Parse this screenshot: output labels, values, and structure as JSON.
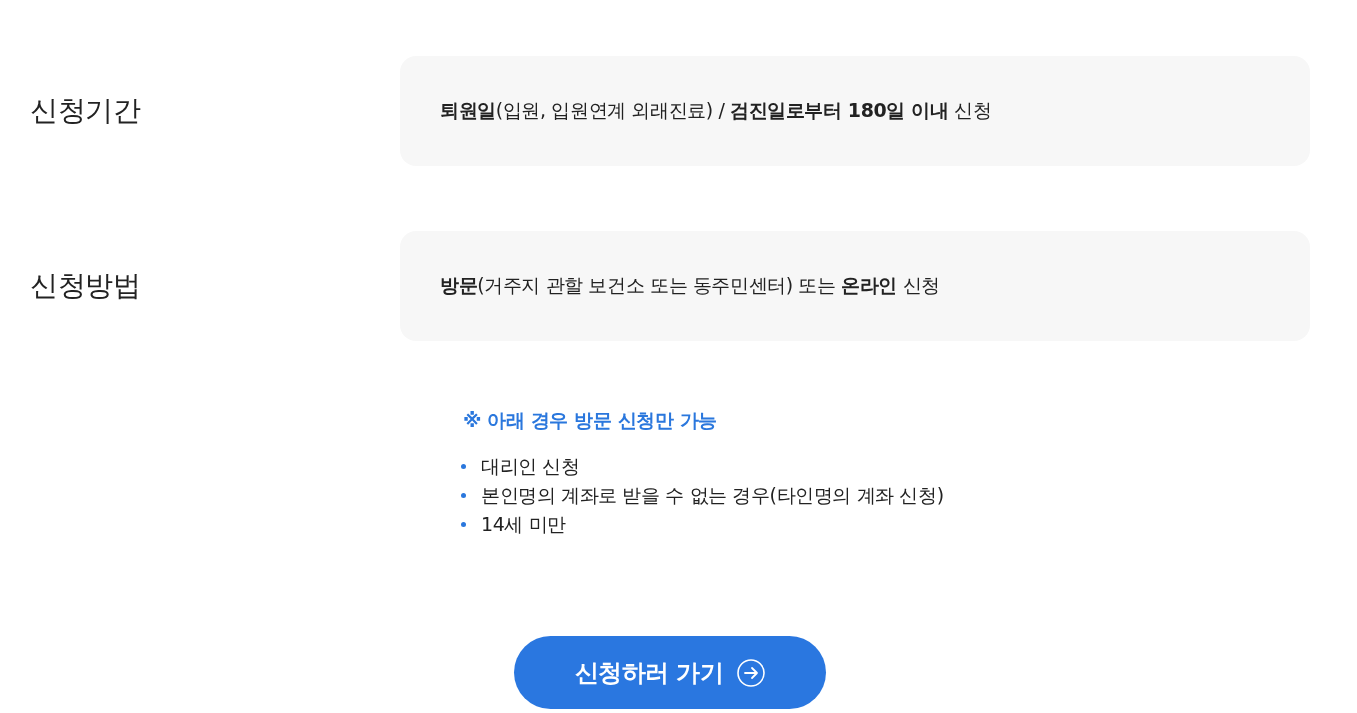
{
  "rows": [
    {
      "label": "신청기간",
      "content": "**퇴원일**(입원, 입원연계 외래진료) / **검진일로부터 180일 이내** 신청"
    },
    {
      "label": "신청방법",
      "content": "**방문**(거주지 관할 보건소 또는 동주민센터) 또는 **온라인** 신청"
    }
  ],
  "notice": {
    "title": "※ 아래 경우 방문 신청만 가능",
    "items": [
      "대리인 신청",
      "본인명의 계좌로 받을 수 없는 경우(타인명의 계좌 신청)",
      "14세 미만"
    ]
  },
  "button": {
    "label": "신청하러 가기"
  }
}
